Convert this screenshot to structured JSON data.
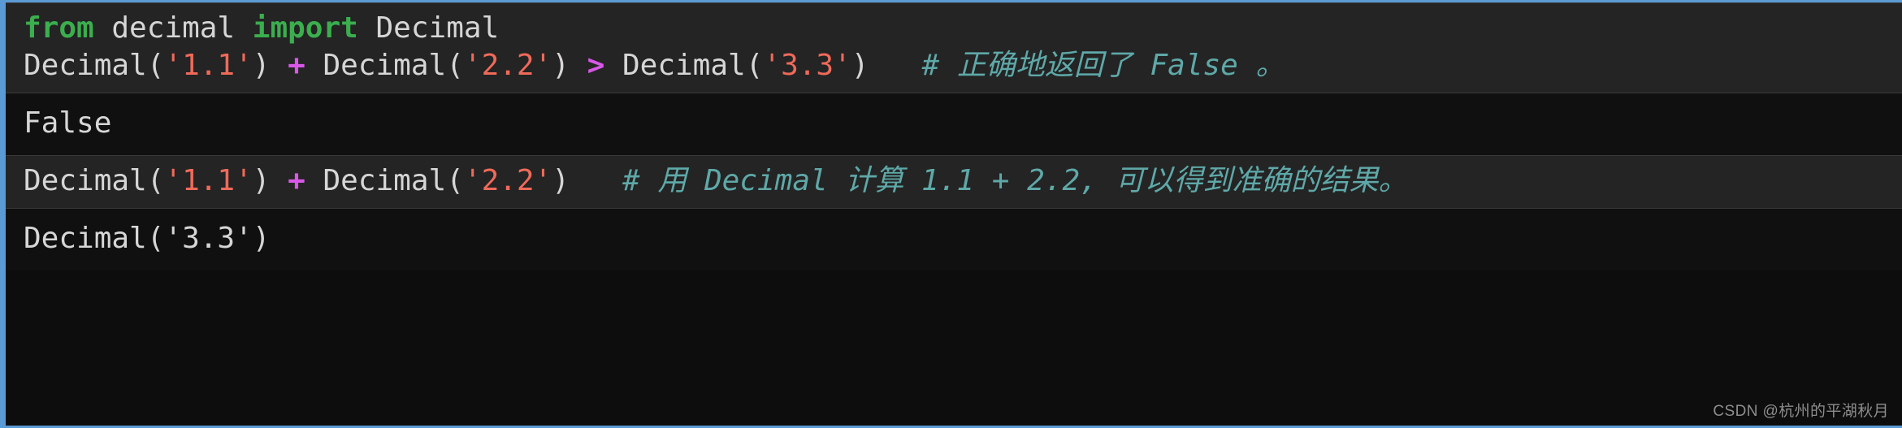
{
  "theme": {
    "accent_rail": "#5b9bd5",
    "input_bg": "#242424",
    "output_bg": "#101010",
    "page_bg": "#0d0d0d",
    "keyword_color": "#3bae4e",
    "string_color": "#ef6a5a",
    "operator_color": "#d957e8",
    "comment_color": "#5fa8a8",
    "text_color": "#d6d6d6"
  },
  "cells": [
    {
      "type": "input",
      "lines": [
        {
          "tokens": [
            {
              "style": "kw",
              "text": "from"
            },
            {
              "style": "plain",
              "text": " decimal "
            },
            {
              "style": "kw",
              "text": "import"
            },
            {
              "style": "plain",
              "text": " Decimal"
            }
          ]
        },
        {
          "tokens": [
            {
              "style": "plain",
              "text": "Decimal("
            },
            {
              "style": "str",
              "text": "'1.1'"
            },
            {
              "style": "plain",
              "text": ") "
            },
            {
              "style": "op",
              "text": "+"
            },
            {
              "style": "plain",
              "text": " Decimal("
            },
            {
              "style": "str",
              "text": "'2.2'"
            },
            {
              "style": "plain",
              "text": ") "
            },
            {
              "style": "op",
              "text": ">"
            },
            {
              "style": "plain",
              "text": " Decimal("
            },
            {
              "style": "str",
              "text": "'3.3'"
            },
            {
              "style": "plain",
              "text": ")   "
            },
            {
              "style": "cmt",
              "text": "# 正确地返回了 False 。"
            }
          ]
        }
      ]
    },
    {
      "type": "output",
      "lines": [
        {
          "tokens": [
            {
              "style": "plain",
              "text": "False"
            }
          ]
        }
      ]
    },
    {
      "type": "input",
      "lines": [
        {
          "tokens": [
            {
              "style": "plain",
              "text": "Decimal("
            },
            {
              "style": "str",
              "text": "'1.1'"
            },
            {
              "style": "plain",
              "text": ") "
            },
            {
              "style": "op",
              "text": "+"
            },
            {
              "style": "plain",
              "text": " Decimal("
            },
            {
              "style": "str",
              "text": "'2.2'"
            },
            {
              "style": "plain",
              "text": ")   "
            },
            {
              "style": "cmt",
              "text": "# 用 Decimal 计算 1.1 + 2.2, 可以得到准确的结果。"
            }
          ]
        }
      ]
    },
    {
      "type": "output",
      "lines": [
        {
          "tokens": [
            {
              "style": "plain",
              "text": "Decimal('3.3')"
            }
          ]
        }
      ]
    }
  ],
  "watermark": {
    "text": "CSDN @杭州的平湖秋月"
  }
}
